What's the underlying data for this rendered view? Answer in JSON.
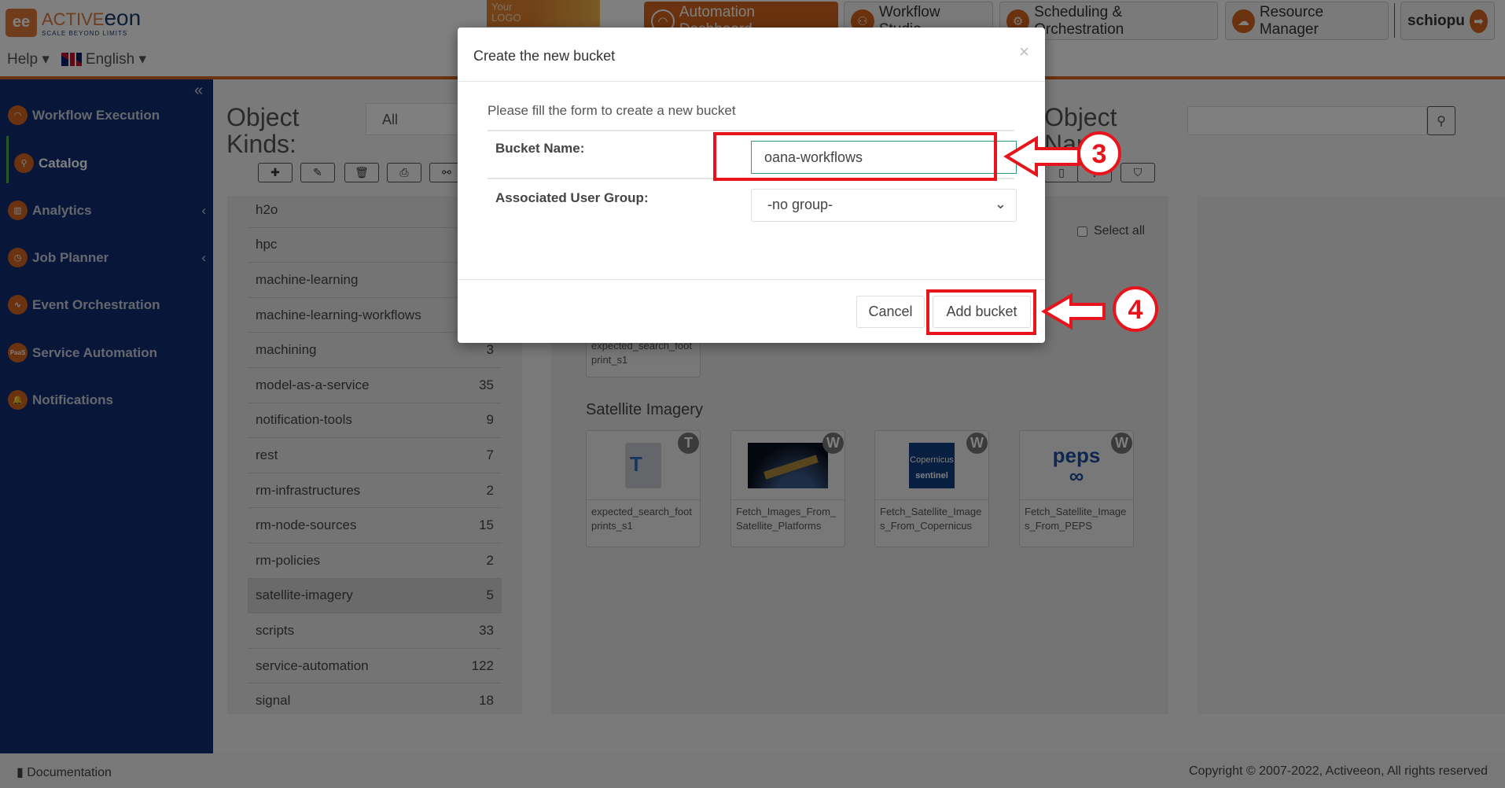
{
  "header": {
    "logo_mark": "ee",
    "logo_brand_a": "ACTIVE",
    "logo_brand_b": "eon",
    "logo_tagline": "SCALE BEYOND LIMITS",
    "help_label": "Help ▾",
    "language_label": "English ▾",
    "custom_logo": "Your\nLOGO",
    "nav": [
      {
        "label": "Automation Dashboard",
        "icon": "gauge-icon"
      },
      {
        "label": "Workflow Studio",
        "icon": "workflow-icon"
      },
      {
        "label": "Scheduling & Orchestration",
        "icon": "gears-icon"
      },
      {
        "label": "Resource Manager",
        "icon": "cloud-icon"
      }
    ],
    "user": "schiopu"
  },
  "sidebar": {
    "items": [
      {
        "label": "Workflow Execution",
        "icon": "gauge-icon"
      },
      {
        "label": "Catalog",
        "icon": "catalog-icon",
        "active": true
      },
      {
        "label": "Analytics",
        "icon": "chart-icon",
        "chevron": "‹"
      },
      {
        "label": "Job Planner",
        "icon": "clock-icon",
        "chevron": "‹"
      },
      {
        "label": "Event Orchestration",
        "icon": "pulse-icon"
      },
      {
        "label": "Service Automation",
        "icon": "paas-icon",
        "icon_text": "PaaS"
      },
      {
        "label": "Notifications",
        "icon": "bell-icon"
      }
    ]
  },
  "catalog": {
    "kinds_title": "Object Kinds:",
    "kinds_filter": "All",
    "object_name_title": "Object Name",
    "select_all": "Select all",
    "kinds": [
      {
        "name": "h2o",
        "count": ""
      },
      {
        "name": "hpc",
        "count": ""
      },
      {
        "name": "machine-learning",
        "count": ""
      },
      {
        "name": "machine-learning-workflows",
        "count": ""
      },
      {
        "name": "machining",
        "count": "3"
      },
      {
        "name": "model-as-a-service",
        "count": "35"
      },
      {
        "name": "notification-tools",
        "count": "9"
      },
      {
        "name": "rest",
        "count": "7"
      },
      {
        "name": "rm-infrastructures",
        "count": "2"
      },
      {
        "name": "rm-node-sources",
        "count": "15"
      },
      {
        "name": "rm-policies",
        "count": "2"
      },
      {
        "name": "satellite-imagery",
        "count": "5",
        "selected": true
      },
      {
        "name": "scripts",
        "count": "33"
      },
      {
        "name": "service-automation",
        "count": "122"
      },
      {
        "name": "signal",
        "count": "18"
      }
    ],
    "partial_card": "expected_search_footprint_s1",
    "section_title": "Satellite Imagery",
    "cards": [
      {
        "name": "expected_search_footprints_s1",
        "badge": "T",
        "thumb": "text-file-icon"
      },
      {
        "name": "Fetch_Images_From_Satellite_Platforms",
        "badge": "W",
        "thumb": "satellite-image"
      },
      {
        "name": "Fetch_Satellite_Images_From_Copernicus",
        "badge": "W",
        "thumb": "copernicus-sentinel-logo",
        "logo_text": "Copernicus sentinel"
      },
      {
        "name": "Fetch_Satellite_Images_From_PEPS",
        "badge": "W",
        "thumb": "peps-logo",
        "logo_text": "peps"
      }
    ]
  },
  "modal": {
    "title": "Create the new bucket",
    "close": "×",
    "instructions": "Please fill the form to create a new bucket",
    "bucket_name_label": "Bucket Name:",
    "bucket_name_value": "oana-workflows",
    "group_label": "Associated User Group:",
    "group_value": "-no group-",
    "cancel": "Cancel",
    "submit": "Add bucket"
  },
  "annotations": {
    "step_a": "3",
    "step_b": "4",
    "color": "#e8141c"
  },
  "footer": {
    "documentation": "Documentation",
    "copyright": "Copyright © 2007-2022, Activeeon, All rights reserved"
  }
}
